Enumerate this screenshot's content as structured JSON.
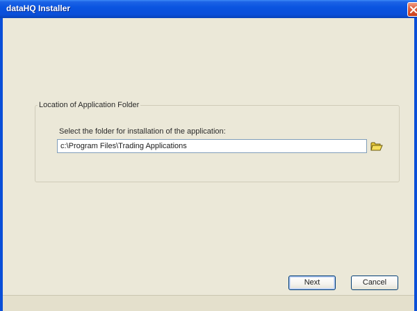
{
  "window": {
    "title": "dataHQ Installer",
    "close_icon": "close-icon"
  },
  "location_group": {
    "legend": "Location of Application Folder",
    "instruction": "Select the folder for installation of the application:",
    "path_value": "c:\\Program Files\\Trading Applications",
    "browse_icon": "folder-icon"
  },
  "buttons": {
    "next_label": "Next",
    "cancel_label": "Cancel"
  },
  "colors": {
    "titlebar": "#0a54e0",
    "client_bg": "#ebe8d8",
    "close_button": "#e0603e"
  }
}
